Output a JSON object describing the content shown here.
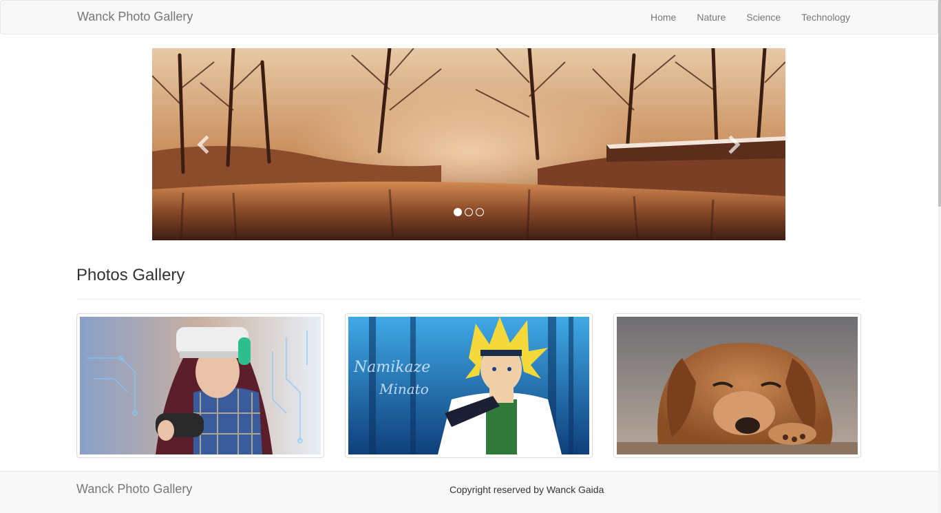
{
  "navbar": {
    "brand": "Wanck Photo Gallery",
    "links": [
      "Home",
      "Nature",
      "Science",
      "Technology"
    ]
  },
  "carousel": {
    "image_icon": "forest-river-photo",
    "prev_icon": "chevron-left-icon",
    "next_icon": "chevron-right-icon",
    "slide_count": 3,
    "active_slide": 1
  },
  "gallery": {
    "title": "Photos Gallery",
    "thumbnails": [
      {
        "image": "vr-gamer-photo"
      },
      {
        "image": "anime-ninja-illustration"
      },
      {
        "image": "sleeping-puppy-photo"
      }
    ],
    "watermark_text": "Namikaze Minato"
  },
  "footer": {
    "brand": "Wanck Photo Gallery",
    "copyright": "Copyright reserved by Wanck Gaida"
  },
  "colors": {
    "navbar_bg": "#f8f8f8",
    "nav_text": "#777777",
    "body_text": "#333333",
    "border": "#e7e7e7"
  }
}
